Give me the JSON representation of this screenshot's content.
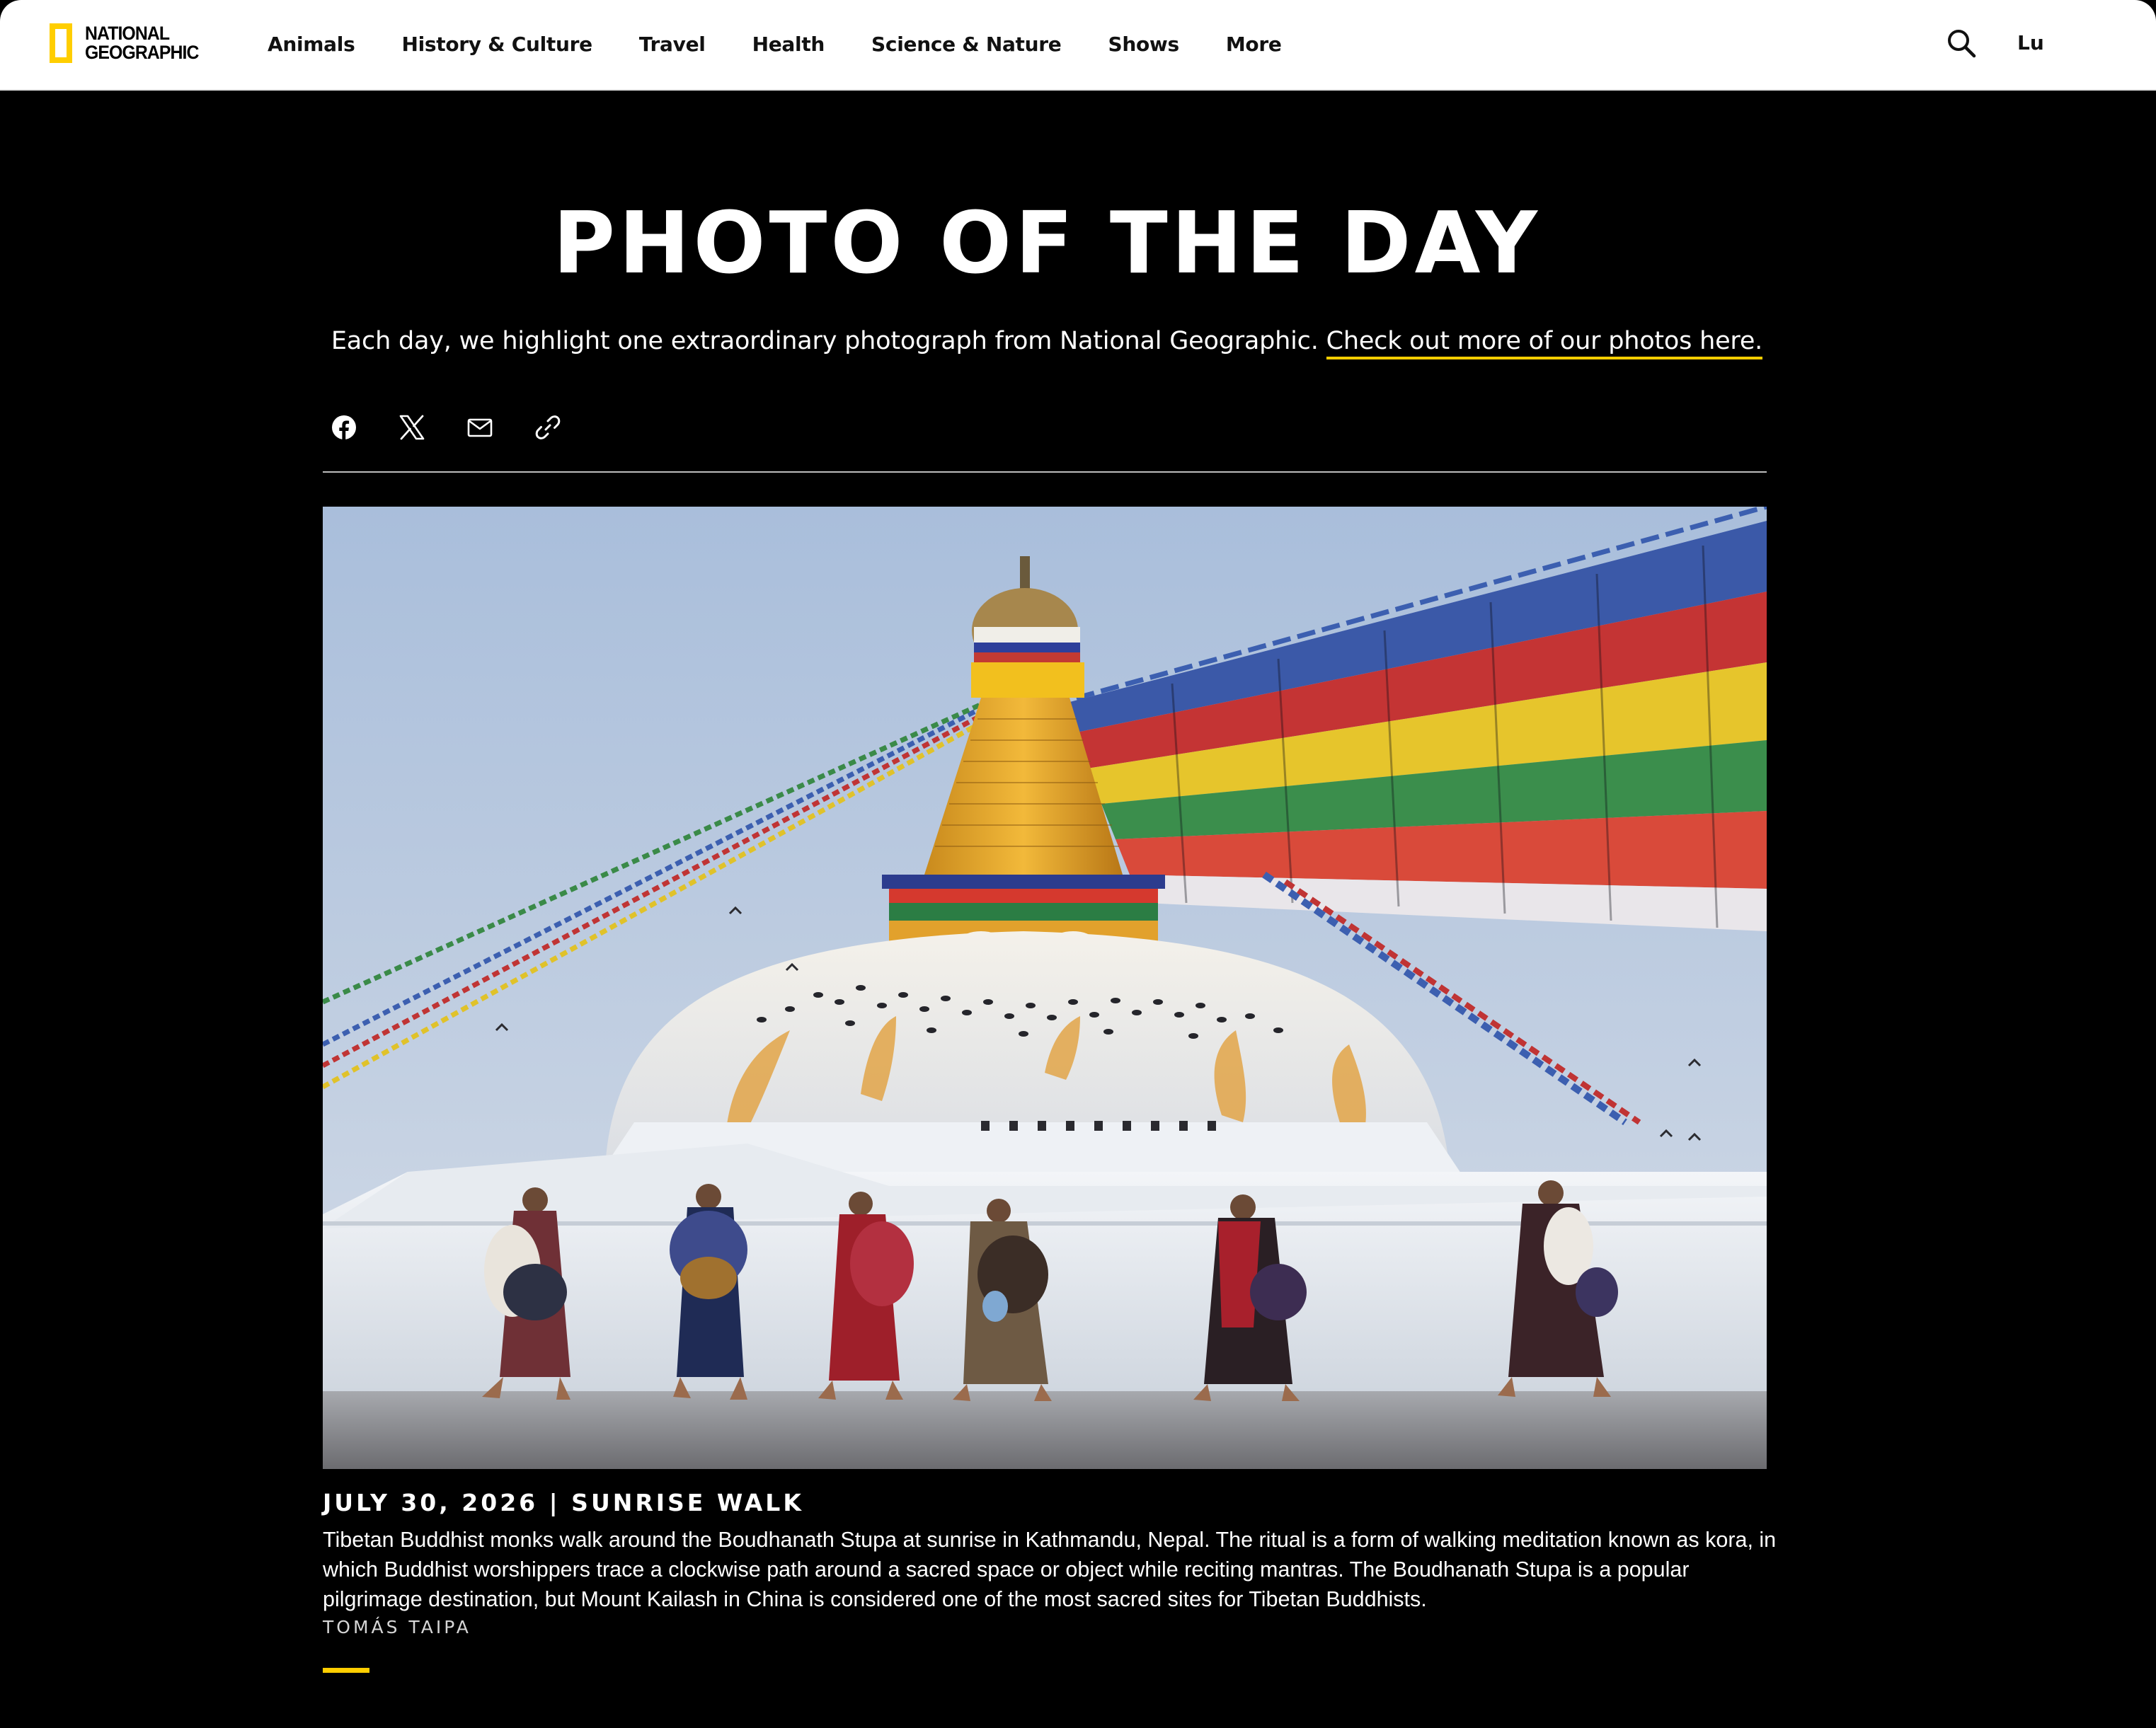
{
  "header": {
    "logo_line1": "National",
    "logo_line2": "Geographic",
    "nav_items": [
      {
        "label": "Animals"
      },
      {
        "label": "History & Culture"
      },
      {
        "label": "Travel"
      },
      {
        "label": "Health"
      },
      {
        "label": "Science & Nature"
      },
      {
        "label": "Shows"
      },
      {
        "label": "More"
      }
    ],
    "search_icon": "search-icon",
    "user_label": "Lu"
  },
  "hero": {
    "title": "PHOTO OF THE DAY",
    "intro_text": "Each day, we highlight one extraordinary photograph from National Geographic.",
    "intro_link": "Check out more of our photos here."
  },
  "share": {
    "icons": [
      "facebook-icon",
      "x-icon",
      "email-icon",
      "link-icon"
    ]
  },
  "photo": {
    "subject": "Tibetan Buddhist monks walking around the Boudhanath Stupa with prayer flags"
  },
  "caption": {
    "title": "JULY 30, 2026 | SUNRISE WALK",
    "text": "Tibetan Buddhist monks walk around the Boudhanath Stupa at sunrise in Kathmandu, Nepal. The ritual is a form of walking meditation known as kora, in which Buddhist worshippers trace a clockwise path around a sacred space or object while reciting mantras. The Boudhanath Stupa is a popular pilgrimage destination, but Mount Kailash in China is considered one of the most sacred sites for Tibetan Buddhists.",
    "credit": "TOMÁS TAIPA"
  },
  "colors": {
    "accent": "#ffce00",
    "background": "#000000",
    "header_bg": "#ffffff"
  }
}
